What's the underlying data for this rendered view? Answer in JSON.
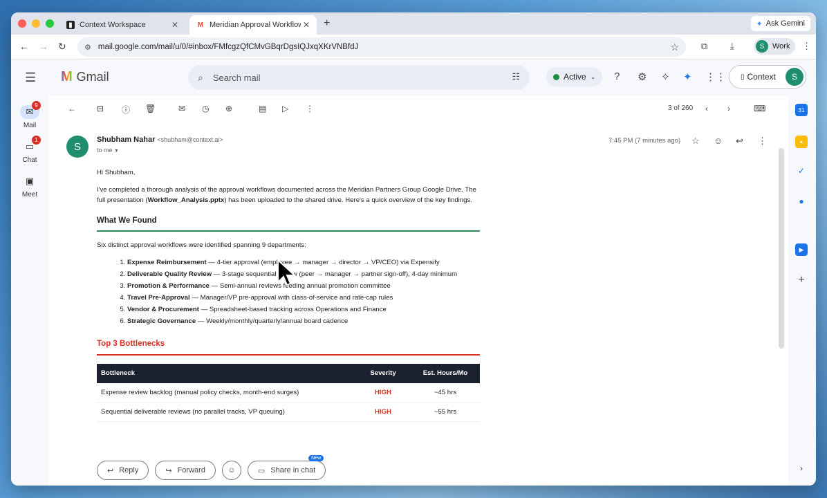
{
  "browser": {
    "tabs": [
      {
        "title": "Context Workspace",
        "close": "✕"
      },
      {
        "title": "Meridian Approval Workflow A",
        "close": "✕"
      }
    ],
    "new_tab": "+",
    "ask_gemini": "Ask Gemini",
    "url": "mail.google.com/mail/u/0/#inbox/FMfcgzQfCMvGBqrDgsIQJxqXKrVNBfdJ",
    "profile_label": "Work",
    "profile_initial": "S"
  },
  "gmail": {
    "app_name": "Gmail",
    "search_placeholder": "Search mail",
    "status": "Active",
    "context_button": "Context",
    "avatar_initial": "S"
  },
  "rail": {
    "items": [
      {
        "label": "Mail",
        "badge": "9"
      },
      {
        "label": "Chat",
        "badge": "1"
      },
      {
        "label": "Meet",
        "badge": ""
      }
    ]
  },
  "toolbar": {
    "pager": "3 of 260"
  },
  "message": {
    "sender_name": "Shubham Nahar",
    "sender_email": "<shubham@context.ai>",
    "to": "to me",
    "time": "7:45 PM (7 minutes ago)",
    "avatar_initial": "S",
    "greeting": "Hi Shubham,",
    "intro_1": "I've completed a thorough analysis of the approval workflows documented across the Meridian Partners Group Google Drive. The full presentation (",
    "intro_file": "Workflow_Analysis.pptx",
    "intro_2": ") has been uploaded to the shared drive. Here's a quick overview of the key findings.",
    "section1_title": "What We Found",
    "section1_lead": "Six distinct approval workflows were identified spanning 9 departments:",
    "workflows": [
      {
        "name": "Expense Reimbursement",
        "desc": " — 4-tier approval (employee → manager → director → VP/CEO) via Expensify"
      },
      {
        "name": "Deliverable Quality Review",
        "desc": " — 3-stage sequential review (peer → manager → partner sign-off), 4-day minimum"
      },
      {
        "name": "Promotion & Performance",
        "desc": " — Semi-annual reviews feeding annual promotion committee"
      },
      {
        "name": "Travel Pre-Approval",
        "desc": " — Manager/VP pre-approval with class-of-service and rate-cap rules"
      },
      {
        "name": "Vendor & Procurement",
        "desc": " — Spreadsheet-based tracking across Operations and Finance"
      },
      {
        "name": "Strategic Governance",
        "desc": " — Weekly/monthly/quarterly/annual board cadence"
      }
    ],
    "section2_title": "Top 3 Bottlenecks",
    "table": {
      "headers": [
        "Bottleneck",
        "Severity",
        "Est. Hours/Mo"
      ],
      "rows": [
        [
          "Expense review backlog (manual policy checks, month-end surges)",
          "HIGH",
          "~45 hrs"
        ],
        [
          "Sequential deliverable reviews (no parallel tracks, VP queuing)",
          "HIGH",
          "~55 hrs"
        ]
      ]
    }
  },
  "actions": {
    "reply": "Reply",
    "forward": "Forward",
    "share": "Share in chat",
    "new_badge": "New"
  },
  "colors": {
    "accent_green": "#2e8b57",
    "danger_red": "#d93025",
    "avatar_green": "#1e8e6e"
  }
}
